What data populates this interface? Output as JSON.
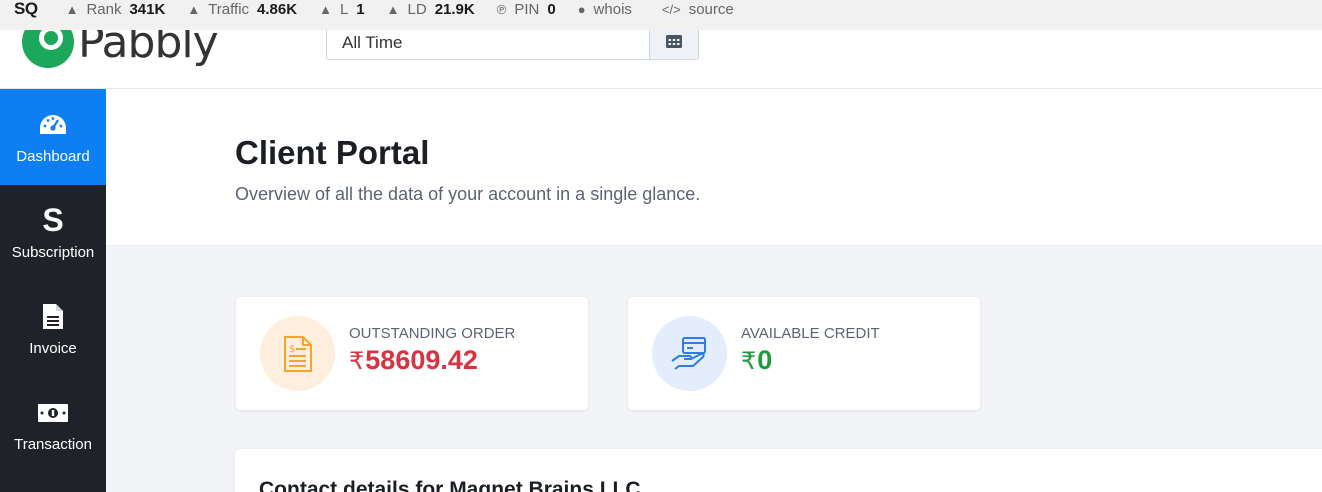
{
  "seo_bar": {
    "logo": "SQ",
    "items": [
      {
        "label": "Rank",
        "value": "341K",
        "icon": "rank-icon"
      },
      {
        "label": "Traffic",
        "value": "4.86K",
        "icon": "traffic-icon"
      },
      {
        "label": "L",
        "value": "1",
        "icon": "links-icon"
      },
      {
        "label": "LD",
        "value": "21.9K",
        "icon": "linking-domains-icon"
      },
      {
        "label": "PIN",
        "value": "0",
        "icon": "pinterest-icon"
      },
      {
        "label": "whois",
        "value": "",
        "icon": "person-icon"
      },
      {
        "label": "source",
        "value": "",
        "icon": "code-icon"
      }
    ]
  },
  "header": {
    "logo_text": "Pabbly",
    "date_filter": "All Time",
    "calendar_icon": "calendar-icon"
  },
  "sidebar": {
    "items": [
      {
        "label": "Dashboard",
        "icon": "dashboard-gauge-icon",
        "active": true
      },
      {
        "label": "Subscription",
        "icon": "subscription-s-icon",
        "active": false
      },
      {
        "label": "Invoice",
        "icon": "invoice-file-icon",
        "active": false
      },
      {
        "label": "Transaction",
        "icon": "money-bill-icon",
        "active": false
      }
    ]
  },
  "page": {
    "title": "Client Portal",
    "subtitle": "Overview of all the data of your account in a single glance."
  },
  "cards": [
    {
      "label": "OUTSTANDING ORDER",
      "currency": "₹",
      "amount": "58609.42",
      "color": "#d93240",
      "icon": "invoice-document-icon",
      "circle_color": "#fdeedd"
    },
    {
      "label": "AVAILABLE CREDIT",
      "currency": "₹",
      "amount": "0",
      "color": "#1e9b3c",
      "icon": "credit-card-hand-icon",
      "circle_color": "#e3edfb"
    }
  ],
  "contact": {
    "title": "Contact details for Magnet Brains LLC"
  }
}
